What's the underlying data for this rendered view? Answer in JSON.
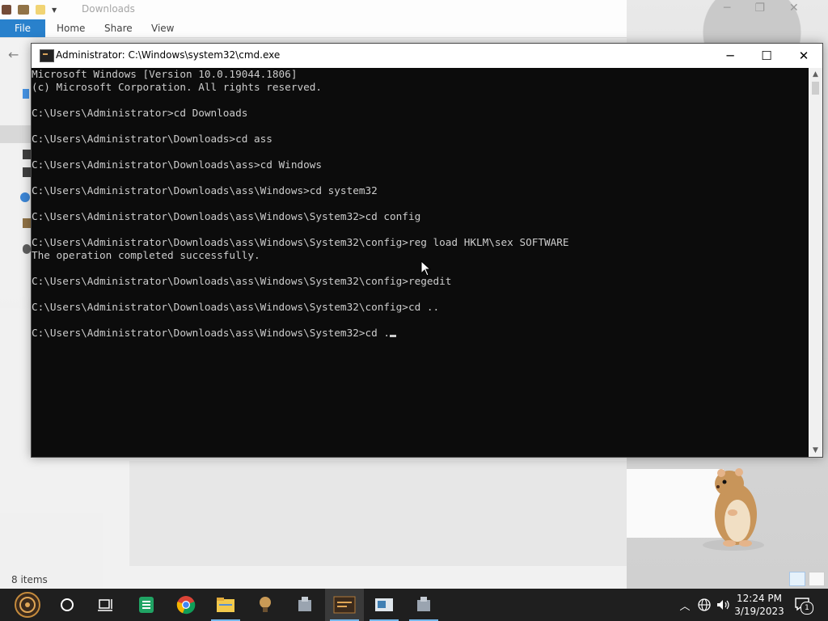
{
  "explorer": {
    "title": "Downloads",
    "ribbon": {
      "file": "File",
      "tabs": [
        "Home",
        "Share",
        "View"
      ]
    },
    "status": "8 items"
  },
  "cmd": {
    "title": "Administrator: C:\\Windows\\system32\\cmd.exe",
    "lines": [
      "Microsoft Windows [Version 10.0.19044.1806]",
      "(c) Microsoft Corporation. All rights reserved.",
      "",
      "C:\\Users\\Administrator>cd Downloads",
      "",
      "C:\\Users\\Administrator\\Downloads>cd ass",
      "",
      "C:\\Users\\Administrator\\Downloads\\ass>cd Windows",
      "",
      "C:\\Users\\Administrator\\Downloads\\ass\\Windows>cd system32",
      "",
      "C:\\Users\\Administrator\\Downloads\\ass\\Windows\\System32>cd config",
      "",
      "C:\\Users\\Administrator\\Downloads\\ass\\Windows\\System32\\config>reg load HKLM\\sex SOFTWARE",
      "The operation completed successfully.",
      "",
      "C:\\Users\\Administrator\\Downloads\\ass\\Windows\\System32\\config>regedit",
      "",
      "C:\\Users\\Administrator\\Downloads\\ass\\Windows\\System32\\config>cd ..",
      "",
      "C:\\Users\\Administrator\\Downloads\\ass\\Windows\\System32>cd ."
    ],
    "controls": {
      "minimize": "─",
      "maximize": "☐",
      "close": "✕"
    }
  },
  "taskbar": {
    "items": [
      "start-icon",
      "cortana-icon",
      "task-view-icon",
      "sheets-icon",
      "chrome-icon",
      "file-explorer-icon",
      "app-icon",
      "app-icon",
      "cmd-icon",
      "app-icon",
      "app-icon"
    ],
    "clock": {
      "time": "12:24 PM",
      "date": "3/19/2023"
    },
    "notification_count": "1"
  },
  "colors": {
    "accent": "#1979ca",
    "console_bg": "#0c0c0c",
    "console_fg": "#cccccc",
    "taskbar_bg": "#1f1f1f"
  }
}
